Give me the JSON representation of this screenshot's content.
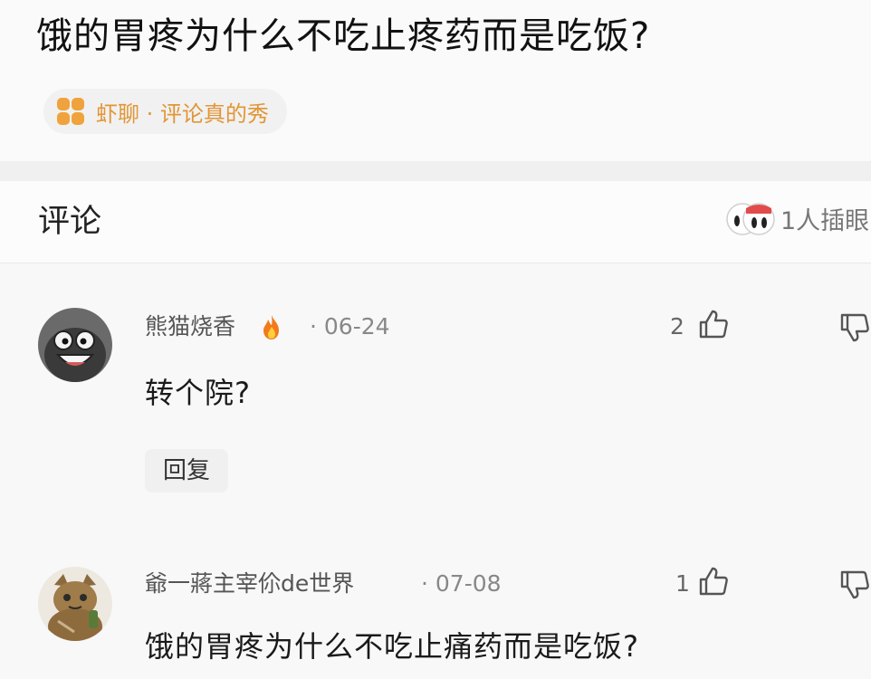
{
  "post": {
    "title": "饿的胃疼为什么不吃止疼药而是吃饭?",
    "topic": "虾聊 · 评论真的秀"
  },
  "comments_section": {
    "title": "评论",
    "viewers": "1人插眼"
  },
  "comments": [
    {
      "username": "熊猫烧香",
      "badge": "fire-icon",
      "date": "· 06-24",
      "likes": "2",
      "text": "转个院?",
      "reply_label": "回复"
    },
    {
      "username": "爺一蔣主宰伱de世界",
      "date": "· 07-08",
      "likes": "1",
      "text": "饿的胃疼为什么不吃止痛药而是吃饭?"
    }
  ],
  "colors": {
    "topic_accent": "#f0a23c",
    "background": "#f8f8f8"
  }
}
